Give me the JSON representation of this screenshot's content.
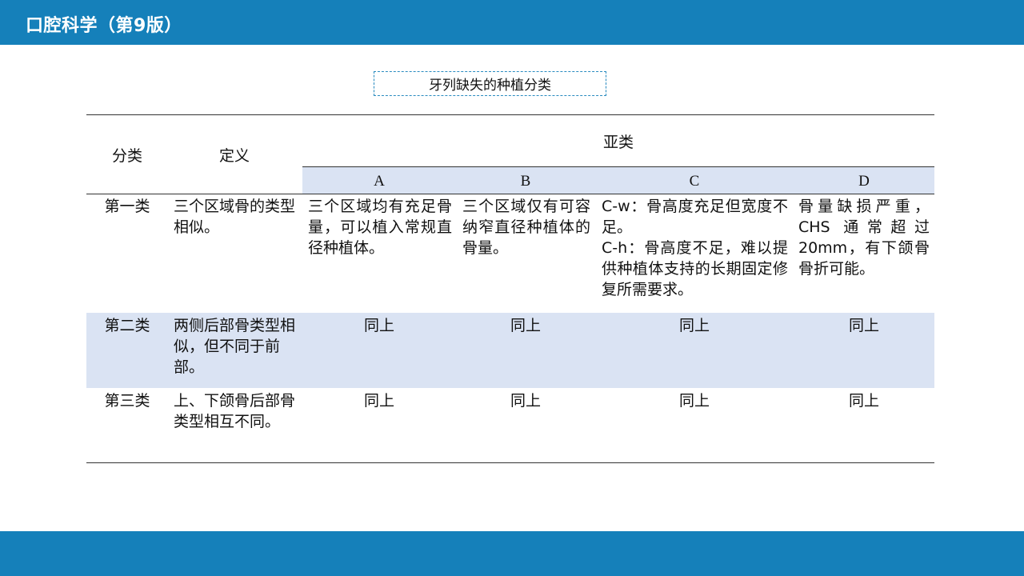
{
  "header": {
    "title": "口腔科学（第9版）"
  },
  "table": {
    "caption": "牙列缺失的种植分类",
    "headers": {
      "category": "分类",
      "definition": "定义",
      "subclass": "亚类",
      "sub": [
        "A",
        "B",
        "C",
        "D"
      ]
    },
    "rows": [
      {
        "category": "第一类",
        "definition": "三个区域骨的类型相似。",
        "a": "三个区域均有充足骨量，可以植入常规直径种植体。",
        "b": "三个区域仅有可容纳窄直径种植体的骨量。",
        "c1": "C-w：骨高度充足但宽度不足。",
        "c2": "C-h：骨高度不足，难以提供种植体支持的长期固定修复所需要求。",
        "d": "骨量缺损严重，CHS 通常超过20mm，有下颌骨骨折可能。"
      },
      {
        "category": "第二类",
        "definition": "两侧后部骨类型相似，但不同于前部。",
        "a": "同上",
        "b": "同上",
        "c": "同上",
        "d": "同上"
      },
      {
        "category": "第三类",
        "definition": "上、下颌骨后部骨类型相互不同。",
        "a": "同上",
        "b": "同上",
        "c": "同上",
        "d": "同上"
      }
    ]
  }
}
